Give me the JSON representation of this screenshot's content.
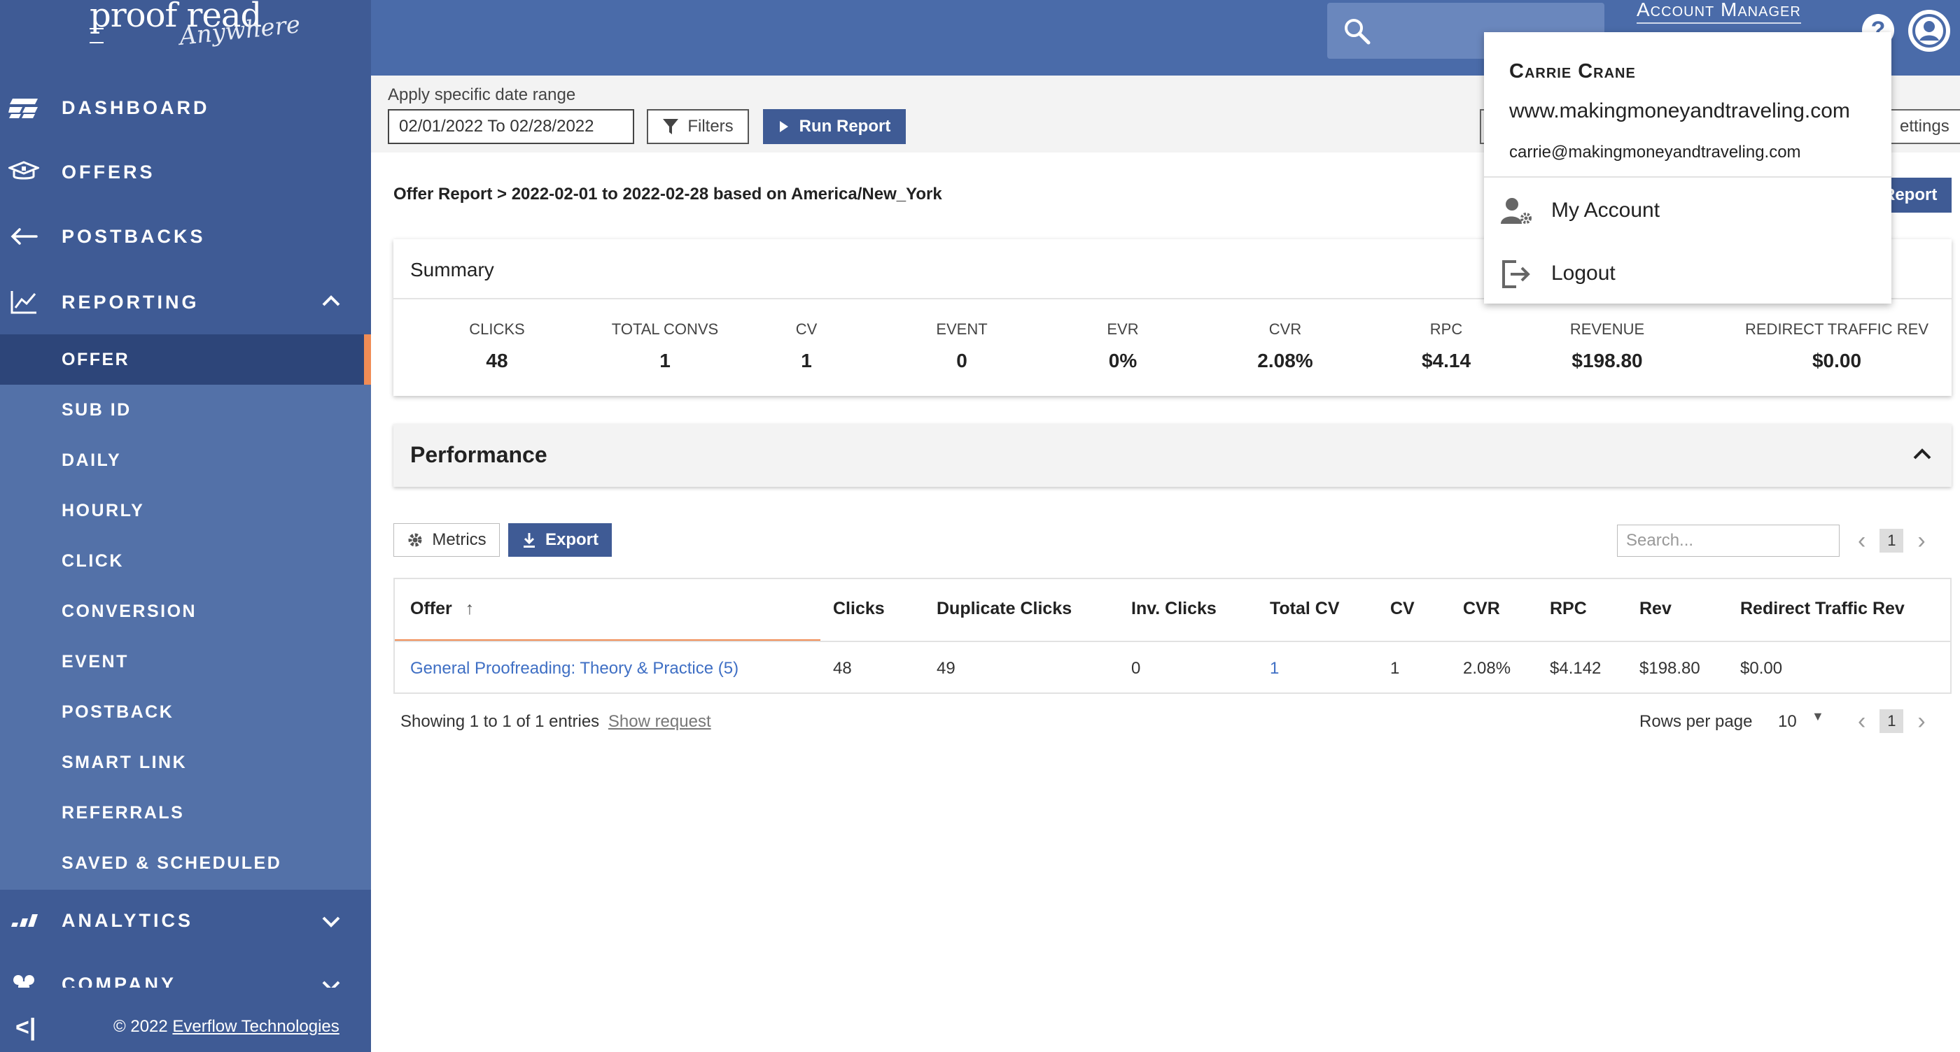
{
  "brand": {
    "logo_main": "proof read",
    "logo_script": "Anywhere"
  },
  "sidebar": {
    "items": [
      {
        "label": "DASHBOARD",
        "icon": "dashboard-icon"
      },
      {
        "label": "OFFERS",
        "icon": "offers-icon"
      },
      {
        "label": "POSTBACKS",
        "icon": "postbacks-icon"
      },
      {
        "label": "REPORTING",
        "icon": "reporting-icon",
        "expanded": true
      },
      {
        "label": "ANALYTICS",
        "icon": "analytics-icon"
      },
      {
        "label": "COMPANY",
        "icon": "company-icon"
      }
    ],
    "reporting_sub": [
      {
        "label": "OFFER",
        "active": true
      },
      {
        "label": "SUB ID"
      },
      {
        "label": "DAILY"
      },
      {
        "label": "HOURLY"
      },
      {
        "label": "CLICK"
      },
      {
        "label": "CONVERSION"
      },
      {
        "label": "EVENT"
      },
      {
        "label": "POSTBACK"
      },
      {
        "label": "SMART LINK"
      },
      {
        "label": "REFERRALS"
      },
      {
        "label": "SAVED & SCHEDULED"
      }
    ],
    "footer": {
      "copyright_prefix": "© 2022",
      "copyright_link": "Everflow Technologies"
    }
  },
  "header": {
    "account_manager_label": "Account Manager"
  },
  "filters": {
    "range_label": "Apply specific date range",
    "date_range_value": "02/01/2022 To 02/28/2022",
    "filters_label": "Filters",
    "run_report_label": "Run Report",
    "settings_label": "ettings"
  },
  "report": {
    "breadcrumb": "Offer Report > 2022-02-01 to 2022-02-28 based on America/New_York",
    "export_report_label": "Report"
  },
  "summary": {
    "title": "Summary",
    "metrics": [
      {
        "label": "CLICKS",
        "value": "48"
      },
      {
        "label": "TOTAL CONVS",
        "value": "1"
      },
      {
        "label": "CV",
        "value": "1"
      },
      {
        "label": "EVENT",
        "value": "0"
      },
      {
        "label": "EVR",
        "value": "0%"
      },
      {
        "label": "CVR",
        "value": "2.08%"
      },
      {
        "label": "RPC",
        "value": "$4.14"
      },
      {
        "label": "REVENUE",
        "value": "$198.80"
      },
      {
        "label": "REDIRECT TRAFFIC REV",
        "value": "$0.00"
      }
    ]
  },
  "performance": {
    "title": "Performance",
    "metrics_label": "Metrics",
    "export_label": "Export",
    "search_placeholder": "Search...",
    "current_page": "1",
    "columns": [
      "Offer",
      "Clicks",
      "Duplicate Clicks",
      "Inv. Clicks",
      "Total CV",
      "CV",
      "CVR",
      "RPC",
      "Rev",
      "Redirect Traffic Rev"
    ],
    "rows": [
      [
        "General Proofreading: Theory & Practice (5)",
        "48",
        "49",
        "0",
        "1",
        "1",
        "2.08%",
        "$4.142",
        "$198.80",
        "$0.00"
      ]
    ],
    "showing_text": "Showing 1 to 1 of 1 entries",
    "show_request_label": "Show request",
    "rows_per_page_label": "Rows per page",
    "rows_per_page_value": "10"
  },
  "account_menu": {
    "name": "Carrie Crane",
    "website": "www.makingmoneyandtraveling.com",
    "email": "carrie@makingmoneyandtraveling.com",
    "items": [
      {
        "label": "My Account",
        "icon": "account-settings-icon"
      },
      {
        "label": "Logout",
        "icon": "logout-icon"
      }
    ]
  },
  "colors": {
    "sidebar": "#3f5b95",
    "sidebar_sub": "#5371a8",
    "sidebar_active": "#2d4579",
    "accent": "#f08c55",
    "topbar": "#4a6ba9",
    "link": "#3f6fc4"
  }
}
